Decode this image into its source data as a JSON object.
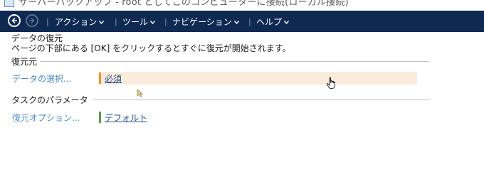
{
  "window": {
    "title": "サーバーバックアップ - root としてこのコンピューターに接続(ローカル接続)"
  },
  "menubar": {
    "items": [
      {
        "label": "アクション"
      },
      {
        "label": "ツール"
      },
      {
        "label": "ナビゲーション"
      },
      {
        "label": "ヘルプ"
      }
    ],
    "separator": "|"
  },
  "page": {
    "title": "データの復元",
    "description": "ページの下部にある [OK] をクリックするとすぐに復元が開始されます。"
  },
  "sections": [
    {
      "title": "復元元",
      "rows": [
        {
          "label": "データの選択...",
          "value": "必須",
          "status_color": "#f0922e"
        }
      ]
    },
    {
      "title": "タスクのパラメータ",
      "rows": [
        {
          "label": "復元オプション...",
          "value": "デフォルト",
          "status_color": "#5e9a48"
        }
      ]
    }
  ],
  "colors": {
    "menubar": "#0f2a52",
    "link": "#4a8cc2",
    "highlight": "#f9ecdd"
  }
}
